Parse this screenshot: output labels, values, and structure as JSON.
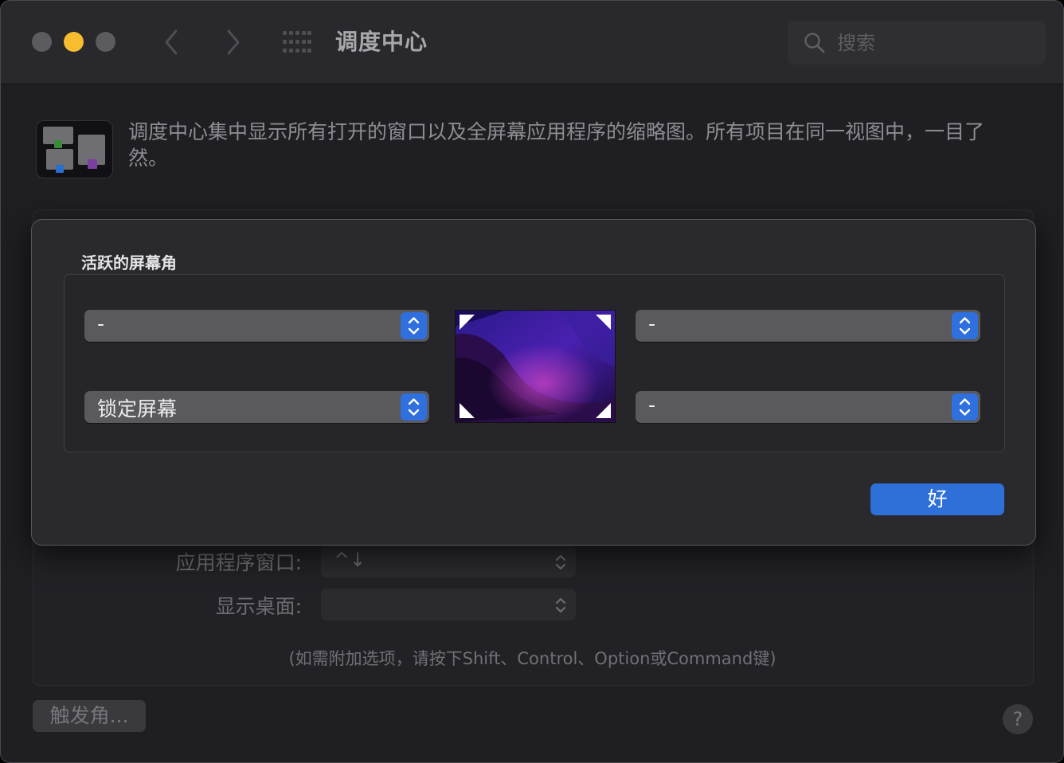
{
  "window": {
    "title": "调度中心",
    "search_placeholder": "搜索"
  },
  "header": {
    "icon": "mission-control-icon",
    "description": "调度中心集中显示所有打开的窗口以及全屏幕应用程序的缩略图。所有项目在同一视图中，一目了然。"
  },
  "background_panel": {
    "app_windows_label": "应用程序窗口:",
    "app_windows_value": "^↓",
    "show_desktop_label": "显示桌面:",
    "show_desktop_value": "",
    "hint": "(如需附加选项，请按下Shift、Control、Option或Command键)",
    "hot_corners_button": "触发角...",
    "help_button": "?"
  },
  "sheet": {
    "title": "活跃的屏幕角",
    "corners": {
      "top_left": "-",
      "top_right": "-",
      "bottom_left": "锁定屏幕",
      "bottom_right": "-"
    },
    "ok_button": "好"
  },
  "colors": {
    "accent": "#2e6fd8",
    "minimize": "#f7bd2f"
  }
}
